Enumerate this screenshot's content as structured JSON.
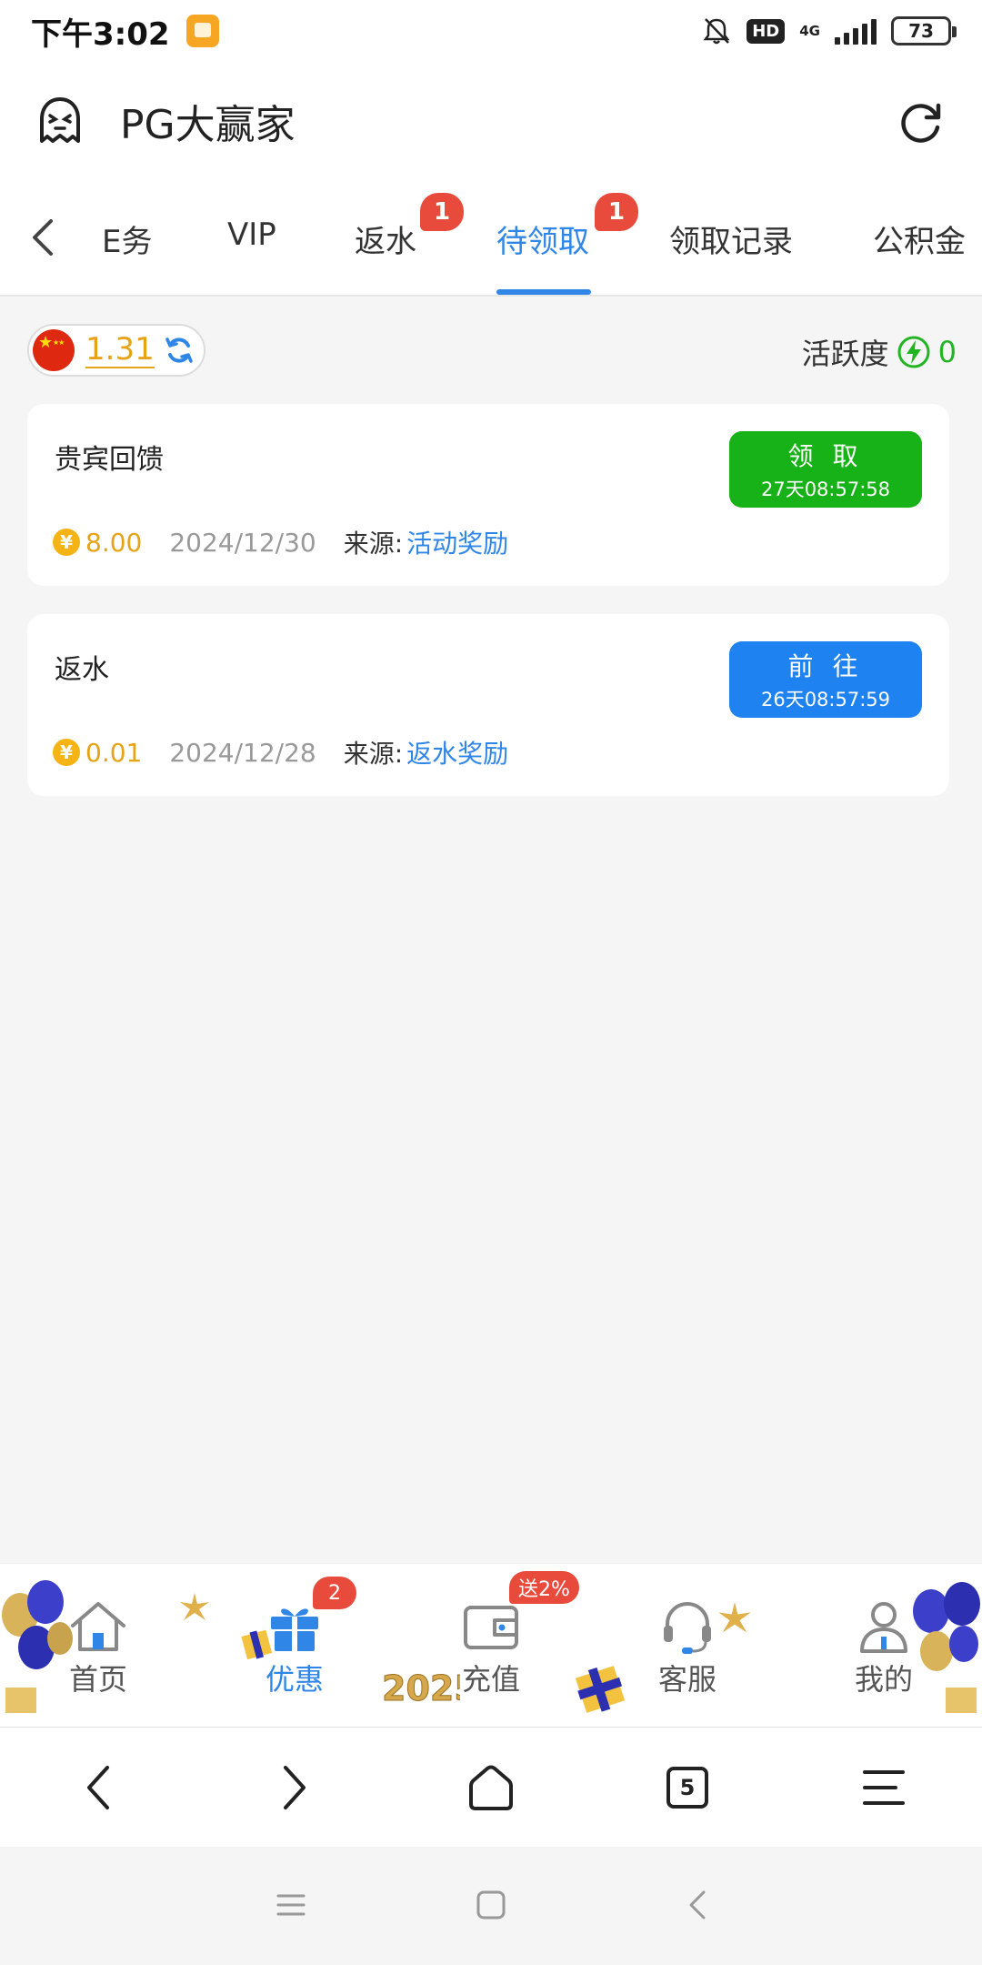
{
  "status_bar": {
    "time": "下午3:02",
    "network_badge": "HD",
    "network_type": "4G",
    "battery": "73"
  },
  "header": {
    "title": "PG大赢家"
  },
  "tabs": [
    {
      "label": "E务"
    },
    {
      "label": "VIP"
    },
    {
      "label": "返水",
      "badge": "1"
    },
    {
      "label": "待领取",
      "badge": "1"
    },
    {
      "label": "领取记录"
    },
    {
      "label": "公积金"
    }
  ],
  "balance": {
    "value": "1.31"
  },
  "activity": {
    "label": "活跃度",
    "value": "0"
  },
  "rewards": [
    {
      "title": "贵宾回馈",
      "amount": "8.00",
      "date": "2024/12/30",
      "source_label": "来源:",
      "source": "活动奖励",
      "button_label": "领 取",
      "countdown": "27天08:57:58",
      "button_color": "#17b217"
    },
    {
      "title": "返水",
      "amount": "0.01",
      "date": "2024/12/28",
      "source_label": "来源:",
      "source": "返水奖励",
      "button_label": "前 往",
      "countdown": "26天08:57:59",
      "button_color": "#1e82f0"
    }
  ],
  "coin_symbol": "¥",
  "bottom_nav": [
    {
      "label": "首页",
      "icon": "home-icon"
    },
    {
      "label": "优惠",
      "icon": "gift-icon",
      "badge": "2"
    },
    {
      "label": "充值",
      "icon": "wallet-icon",
      "badge": "送2%"
    },
    {
      "label": "客服",
      "icon": "headset-icon"
    },
    {
      "label": "我的",
      "icon": "user-icon"
    }
  ],
  "browser": {
    "tab_count": "5"
  },
  "colors": {
    "accent": "#2f86e6",
    "badge": "#e84a3c",
    "amount": "#e6a318",
    "active_green": "#22b422"
  }
}
